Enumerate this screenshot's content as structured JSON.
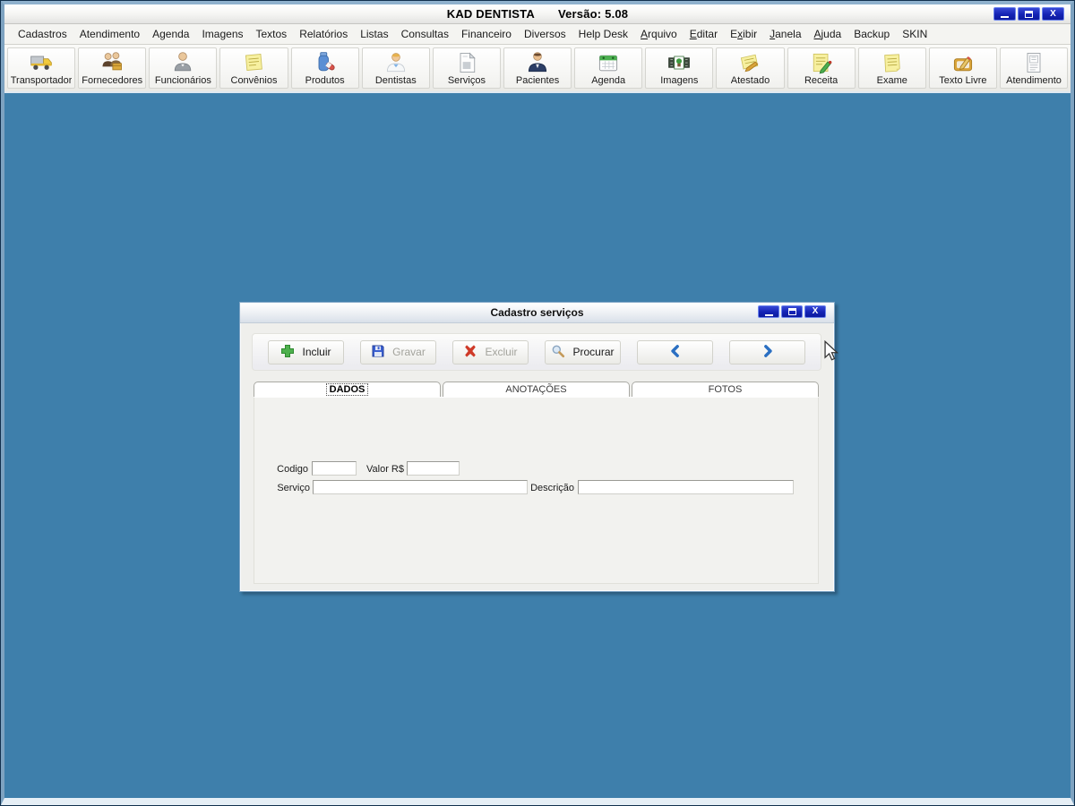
{
  "window": {
    "title_app": "KAD DENTISTA",
    "title_version": "Versão: 5.08"
  },
  "glyphs": {
    "close": "X"
  },
  "colors": {
    "desktop": "#3e7fab",
    "window_button_blue": "#1423b4",
    "disabled_text": "#a3a39c",
    "accent_green": "#4db04d",
    "accent_red": "#cf3a28",
    "accent_blue": "#2a6fc2"
  },
  "menubar": {
    "items": [
      {
        "label": "Cadastros",
        "mnemonic": -1
      },
      {
        "label": "Atendimento",
        "mnemonic": -1
      },
      {
        "label": "Agenda",
        "mnemonic": -1
      },
      {
        "label": "Imagens",
        "mnemonic": -1
      },
      {
        "label": "Textos",
        "mnemonic": -1
      },
      {
        "label": "Relatórios",
        "mnemonic": -1
      },
      {
        "label": "Listas",
        "mnemonic": -1
      },
      {
        "label": "Consultas",
        "mnemonic": -1
      },
      {
        "label": "Financeiro",
        "mnemonic": -1
      },
      {
        "label": "Diversos",
        "mnemonic": -1
      },
      {
        "label": "Help Desk",
        "mnemonic": -1
      },
      {
        "label": "Arquivo",
        "mnemonic": 0
      },
      {
        "label": "Editar",
        "mnemonic": 0
      },
      {
        "label": "Exibir",
        "mnemonic": 1
      },
      {
        "label": "Janela",
        "mnemonic": 0
      },
      {
        "label": "Ajuda",
        "mnemonic": 0
      },
      {
        "label": "Backup",
        "mnemonic": -1
      },
      {
        "label": "SKIN",
        "mnemonic": -1
      }
    ]
  },
  "toolbar": {
    "buttons": [
      {
        "label": "Transportador",
        "icon": "truck-icon"
      },
      {
        "label": "Fornecedores",
        "icon": "suppliers-icon"
      },
      {
        "label": "Funcionários",
        "icon": "employee-icon"
      },
      {
        "label": "Convênios",
        "icon": "agreement-note-icon"
      },
      {
        "label": "Produtos",
        "icon": "products-icon"
      },
      {
        "label": "Dentistas",
        "icon": "dentist-icon"
      },
      {
        "label": "Serviços",
        "icon": "services-document-icon"
      },
      {
        "label": "Pacientes",
        "icon": "patient-icon"
      },
      {
        "label": "Agenda",
        "icon": "calendar-icon"
      },
      {
        "label": "Imagens",
        "icon": "images-icon"
      },
      {
        "label": "Atestado",
        "icon": "certificate-icon"
      },
      {
        "label": "Receita",
        "icon": "prescription-icon"
      },
      {
        "label": "Exame",
        "icon": "exam-note-icon"
      },
      {
        "label": "Texto Livre",
        "icon": "free-text-icon"
      },
      {
        "label": "Atendimento",
        "icon": "attendance-form-icon"
      }
    ]
  },
  "dialog": {
    "title": "Cadastro serviços",
    "actions": [
      {
        "label": "Incluir",
        "enabled": true,
        "icon": "plus-icon"
      },
      {
        "label": "Gravar",
        "enabled": false,
        "icon": "save-icon"
      },
      {
        "label": "Excluir",
        "enabled": false,
        "icon": "delete-icon"
      },
      {
        "label": "Procurar",
        "enabled": true,
        "icon": "search-icon"
      },
      {
        "label": "",
        "enabled": true,
        "icon": "chevron-left-icon"
      },
      {
        "label": "",
        "enabled": true,
        "icon": "chevron-right-icon"
      }
    ],
    "tabs": [
      {
        "label": "DADOS",
        "active": true
      },
      {
        "label": "ANOTAÇÕES",
        "active": false
      },
      {
        "label": "FOTOS",
        "active": false
      }
    ],
    "fields": [
      {
        "label": "Codigo",
        "value": ""
      },
      {
        "label": "Valor R$",
        "value": ""
      },
      {
        "label": "Serviço",
        "value": ""
      },
      {
        "label": "Descrição",
        "value": ""
      }
    ]
  }
}
